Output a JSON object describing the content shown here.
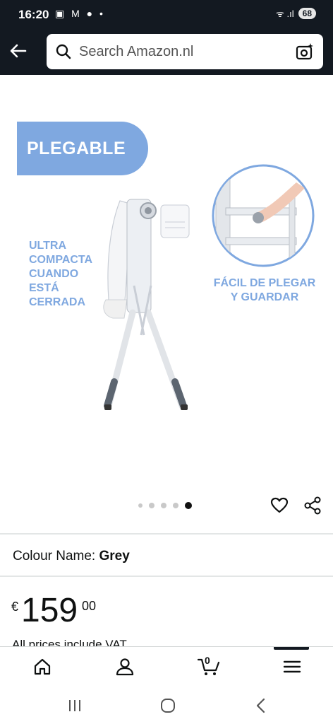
{
  "status_bar": {
    "time": "16:20",
    "left_icons": "▣ M ● •",
    "signal": "ᯤ .ıl",
    "battery": "68"
  },
  "header": {
    "search_placeholder": "Search Amazon.nl"
  },
  "product_image": {
    "banner": "PLEGABLE",
    "left_caption": "ULTRA\nCOMPACTA\nCUANDO\nESTÁ\nCERRADA",
    "right_caption": "FÁCIL DE PLEGAR\nY GUARDAR",
    "carousel": {
      "total": 5,
      "active_index": 4
    }
  },
  "colour": {
    "label": "Colour Name:",
    "value": "Grey"
  },
  "price": {
    "symbol": "€",
    "whole": "159",
    "fraction": "00"
  },
  "vat_note": "All prices include VAT",
  "bottom_nav": {
    "cart_count": "0"
  },
  "colors": {
    "header_bg": "#131921",
    "accent_blue": "#7fa8e0"
  }
}
